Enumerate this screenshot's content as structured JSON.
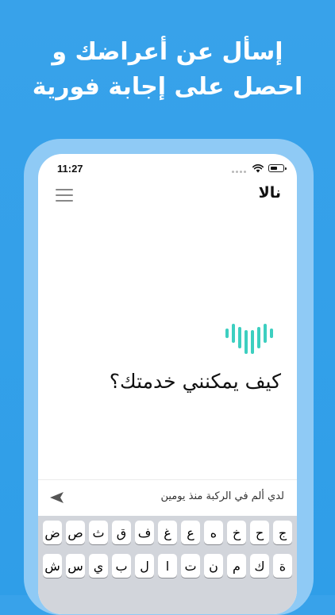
{
  "headline": {
    "line1": "إسأل عن أعراضك و",
    "line2": "احصل على إجابة فورية"
  },
  "status_bar": {
    "time": "11:27",
    "icons": [
      "signal-icon",
      "wifi-icon",
      "battery-icon"
    ]
  },
  "app": {
    "title": "نالا",
    "menu_icon": "hamburger-menu-icon",
    "logo_icon": "heart-wave-logo-icon",
    "greeting": "كيف يمكنني خدمتك؟"
  },
  "input": {
    "value": "لدي ألم في الركبة منذ يومين",
    "send_icon": "send-arrow-icon"
  },
  "keyboard": {
    "row1": [
      "ج",
      "ح",
      "خ",
      "ه",
      "ع",
      "غ",
      "ف",
      "ق",
      "ث",
      "ص",
      "ض"
    ],
    "row2": [
      "ة",
      "ك",
      "م",
      "ن",
      "ت",
      "ا",
      "ل",
      "ب",
      "ي",
      "س",
      "ش"
    ]
  },
  "colors": {
    "background": "#2f9ee8",
    "phone_frame": "#8fcaf5",
    "logo_accent": "#3dcfc0",
    "keyboard_bg": "#d2d5db"
  }
}
